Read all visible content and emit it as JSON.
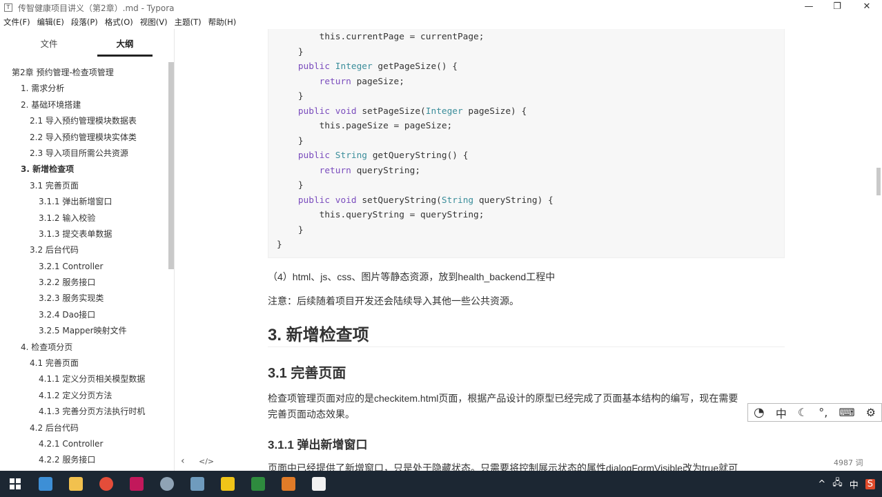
{
  "window": {
    "title": "传智健康项目讲义（第2章）.md - Typora",
    "minimize": "—",
    "maximize": "❐",
    "close": "✕"
  },
  "menu": [
    "文件(F)",
    "编辑(E)",
    "段落(P)",
    "格式(O)",
    "视图(V)",
    "主题(T)",
    "帮助(H)"
  ],
  "sidebar": {
    "tabs": [
      "文件",
      "大纲"
    ],
    "outline": [
      {
        "label": "第2章 预约管理-检查项管理",
        "level": 0
      },
      {
        "label": "1. 需求分析",
        "level": 1
      },
      {
        "label": "2. 基础环境搭建",
        "level": 1
      },
      {
        "label": "2.1 导入预约管理模块数据表",
        "level": 2
      },
      {
        "label": "2.2 导入预约管理模块实体类",
        "level": 2
      },
      {
        "label": "2.3 导入项目所需公共资源",
        "level": 2
      },
      {
        "label": "3. 新增检查项",
        "level": 1,
        "active": true
      },
      {
        "label": "3.1 完善页面",
        "level": 2
      },
      {
        "label": "3.1.1 弹出新增窗口",
        "level": 3
      },
      {
        "label": "3.1.2 输入校验",
        "level": 3
      },
      {
        "label": "3.1.3 提交表单数据",
        "level": 3
      },
      {
        "label": "3.2 后台代码",
        "level": 2
      },
      {
        "label": "3.2.1 Controller",
        "level": 3
      },
      {
        "label": "3.2.2 服务接口",
        "level": 3
      },
      {
        "label": "3.2.3 服务实现类",
        "level": 3
      },
      {
        "label": "3.2.4 Dao接口",
        "level": 3
      },
      {
        "label": "3.2.5 Mapper映射文件",
        "level": 3
      },
      {
        "label": "4. 检查项分页",
        "level": 1
      },
      {
        "label": "4.1 完善页面",
        "level": 2
      },
      {
        "label": "4.1.1 定义分页相关模型数据",
        "level": 3
      },
      {
        "label": "4.1.2 定义分页方法",
        "level": 3
      },
      {
        "label": "4.1.3 完善分页方法执行时机",
        "level": 3
      },
      {
        "label": "4.2 后台代码",
        "level": 2
      },
      {
        "label": "4.2.1 Controller",
        "level": 3
      },
      {
        "label": "4.2.2 服务接口",
        "level": 3
      }
    ],
    "footer_back": "‹",
    "footer_source": "</>"
  },
  "content": {
    "code_lines": [
      [
        {
          "t": "        this.currentPage = currentPage;"
        }
      ],
      [
        {
          "t": "    }"
        }
      ],
      [
        {
          "t": "    "
        },
        {
          "t": "public",
          "c": "kw"
        },
        {
          "t": " "
        },
        {
          "t": "Integer",
          "c": "ty"
        },
        {
          "t": " getPageSize() {"
        }
      ],
      [
        {
          "t": "        "
        },
        {
          "t": "return",
          "c": "kw"
        },
        {
          "t": " pageSize;"
        }
      ],
      [
        {
          "t": "    }"
        }
      ],
      [
        {
          "t": "    "
        },
        {
          "t": "public",
          "c": "kw"
        },
        {
          "t": " "
        },
        {
          "t": "void",
          "c": "kw"
        },
        {
          "t": " setPageSize("
        },
        {
          "t": "Integer",
          "c": "ty"
        },
        {
          "t": " pageSize) {"
        }
      ],
      [
        {
          "t": "        this.pageSize = pageSize;"
        }
      ],
      [
        {
          "t": "    }"
        }
      ],
      [
        {
          "t": "    "
        },
        {
          "t": "public",
          "c": "kw"
        },
        {
          "t": " "
        },
        {
          "t": "String",
          "c": "ty"
        },
        {
          "t": " getQueryString() {"
        }
      ],
      [
        {
          "t": "        "
        },
        {
          "t": "return",
          "c": "kw"
        },
        {
          "t": " queryString;"
        }
      ],
      [
        {
          "t": "    }"
        }
      ],
      [
        {
          "t": "    "
        },
        {
          "t": "public",
          "c": "kw"
        },
        {
          "t": " "
        },
        {
          "t": "void",
          "c": "kw"
        },
        {
          "t": " setQueryString("
        },
        {
          "t": "String",
          "c": "ty"
        },
        {
          "t": " queryString) {"
        }
      ],
      [
        {
          "t": "        this.queryString = queryString;"
        }
      ],
      [
        {
          "t": "    }"
        }
      ],
      [
        {
          "t": "}"
        }
      ]
    ],
    "para1": "（4）html、js、css、图片等静态资源，放到health_backend工程中",
    "para2": "注意：后续随着项目开发还会陆续导入其他一些公共资源。",
    "h2": "3. 新增检查项",
    "h3": "3.1 完善页面",
    "para3a": "检查项管理页面对应的是checkitem.html页面，根据产品设计的原型已经完成了页面基本结构的编写，现在需要",
    "para3b": "完善页面动态效果。",
    "h4": "3.1.1 弹出新增窗口",
    "para4": "页面中已经提供了新增窗口，只是处于隐藏状态。只需要将控制展示状态的属性dialogFormVisible改为true就可"
  },
  "status": {
    "word_count": "4987 词"
  },
  "ime": [
    "中",
    "☾",
    "°,",
    "⌨",
    "⚙"
  ],
  "taskbar": {
    "icons": [
      "windows-start",
      "explorer",
      "file-manager",
      "chrome",
      "intellij",
      "app",
      "app2",
      "app3",
      "app4",
      "app5",
      "typora"
    ],
    "tray": [
      "^",
      "🖧",
      "中",
      "S"
    ]
  }
}
